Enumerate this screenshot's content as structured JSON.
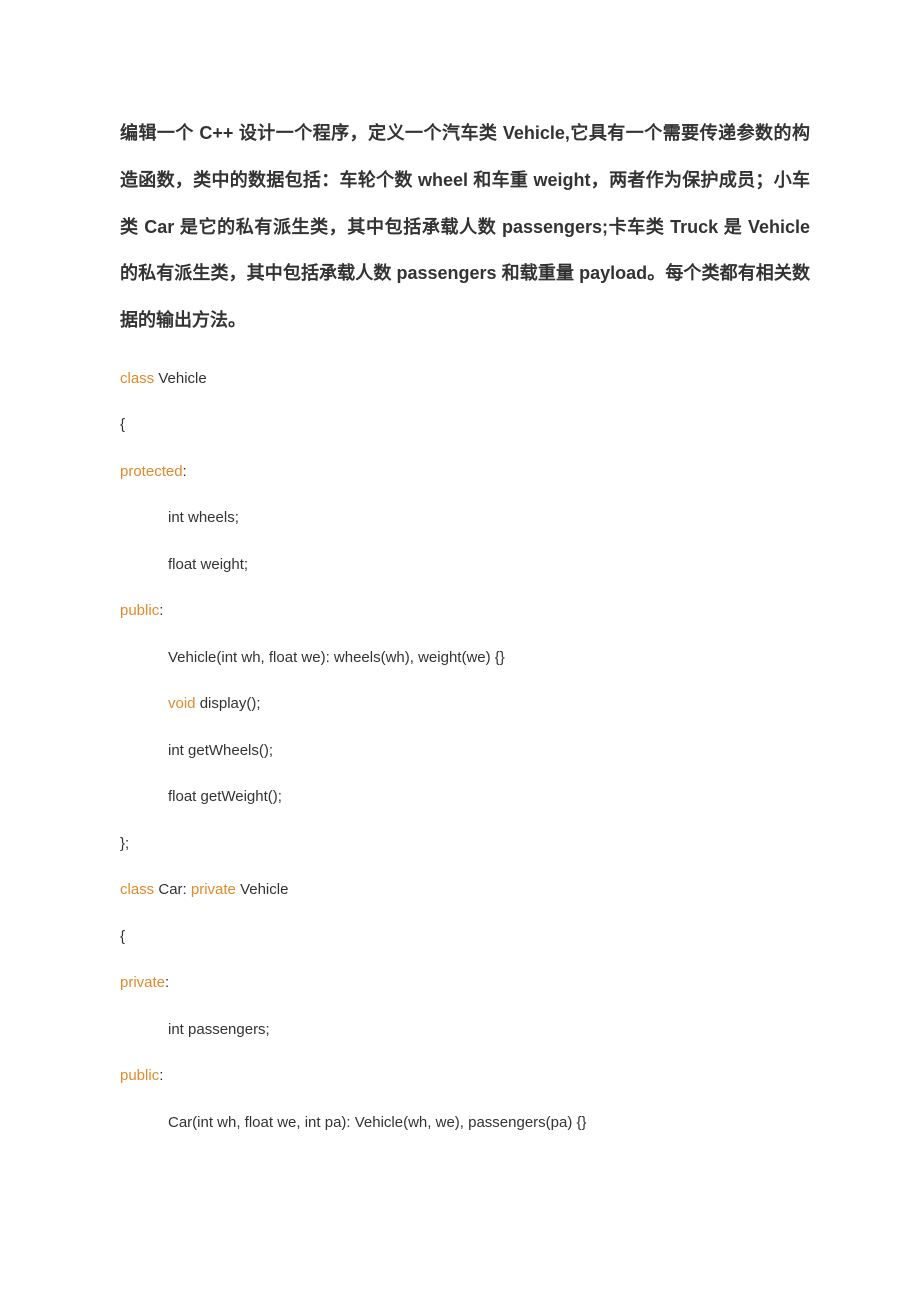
{
  "title": "编辑一个 C++ 设计一个程序，定义一个汽车类 Vehicle,它具有一个需要传递参数的构造函数，类中的数据包括：车轮个数 wheel 和车重 weight，两者作为保护成员；小车类 Car 是它的私有派生类，其中包括承载人数 passengers;卡车类 Truck 是 Vehicle 的私有派生类，其中包括承载人数 passengers 和载重量 payload。每个类都有相关数据的输出方法。",
  "code": {
    "l1_kw": "class",
    "l1_rest": " Vehicle",
    "l2": "{",
    "l3_kw": "protected",
    "l3_colon": ":",
    "l4": "int wheels;",
    "l5": "float weight;",
    "l6_kw": "public",
    "l6_colon": ":",
    "l7": "Vehicle(int wh, float we): wheels(wh), weight(we) {}",
    "l8_kw": "void",
    "l8_rest": " display();",
    "l9": "int getWheels();",
    "l10": "float getWeight();",
    "l11": "};",
    "l12_kw1": "class",
    "l12_mid": " Car: ",
    "l12_kw2": "private",
    "l12_rest": " Vehicle",
    "l13": "{",
    "l14_kw": "private",
    "l14_colon": ":",
    "l15": "int passengers;",
    "l16_kw": "public",
    "l16_colon": ":",
    "l17": "Car(int wh, float we, int pa): Vehicle(wh, we), passengers(pa) {}"
  }
}
